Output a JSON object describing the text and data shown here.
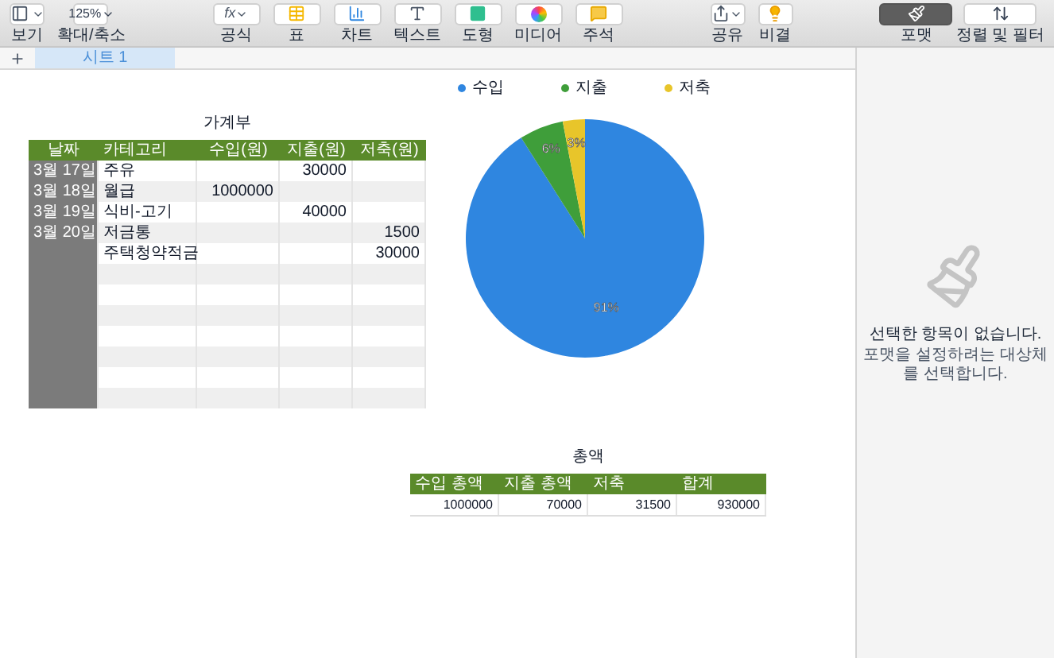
{
  "toolbar": {
    "left": [
      {
        "kind": "view",
        "label": "보기"
      },
      {
        "kind": "zoom",
        "value": "125%",
        "label": "확대/축소"
      }
    ],
    "insert": [
      {
        "kind": "formula",
        "glyph": "fx",
        "label": "공식"
      },
      {
        "kind": "table",
        "label": "표"
      },
      {
        "kind": "chart",
        "label": "차트"
      },
      {
        "kind": "text",
        "label": "텍스트"
      },
      {
        "kind": "shape",
        "label": "도형"
      },
      {
        "kind": "media",
        "label": "미디어"
      },
      {
        "kind": "comment",
        "label": "주석"
      }
    ],
    "share": [
      {
        "kind": "share",
        "label": "공유"
      },
      {
        "kind": "tips",
        "label": "비결"
      }
    ],
    "panels": [
      {
        "kind": "format",
        "label": "포맷",
        "selected": true
      },
      {
        "kind": "sort",
        "label": "정렬 및 필터",
        "selected": false
      }
    ]
  },
  "sheet_tabs": [
    {
      "label": "시트 1",
      "selected": true
    }
  ],
  "ledger": {
    "title": "가계부",
    "columns": [
      "날짜",
      "카테고리",
      "수입(원)",
      "지출(원)",
      "저축(원)"
    ],
    "rows": [
      {
        "date": "3월 17일",
        "category": "주유",
        "expense": "30000"
      },
      {
        "date": "3월 18일",
        "category": "월급",
        "income": "1000000"
      },
      {
        "date": "3월 19일",
        "category": "식비-고기",
        "expense": "40000"
      },
      {
        "date": "3월 20일",
        "category": "저금통",
        "saving": "1500"
      },
      {
        "category": "주택청약적금",
        "saving": "30000"
      },
      {},
      {},
      {},
      {},
      {},
      {},
      {}
    ]
  },
  "chart": {
    "chart_data": {
      "type": "pie",
      "legend": true,
      "categories": [
        "수입",
        "지출",
        "저축"
      ],
      "values": [
        91,
        6,
        3
      ],
      "colors": [
        "#2f86e0",
        "#3f9e3a",
        "#e8c52a"
      ],
      "value_labels": [
        "91%",
        "6%",
        "3%"
      ]
    }
  },
  "totals": {
    "title": "총액",
    "columns": [
      "수입 총액",
      "지출 총액",
      "저축",
      "합계"
    ],
    "values": [
      "1000000",
      "70000",
      "31500",
      "930000"
    ]
  },
  "sidebar": {
    "message": "선택한 항목이 없습니다.",
    "hint": "포맷을 설정하려는 대상체를 선택합니다."
  }
}
